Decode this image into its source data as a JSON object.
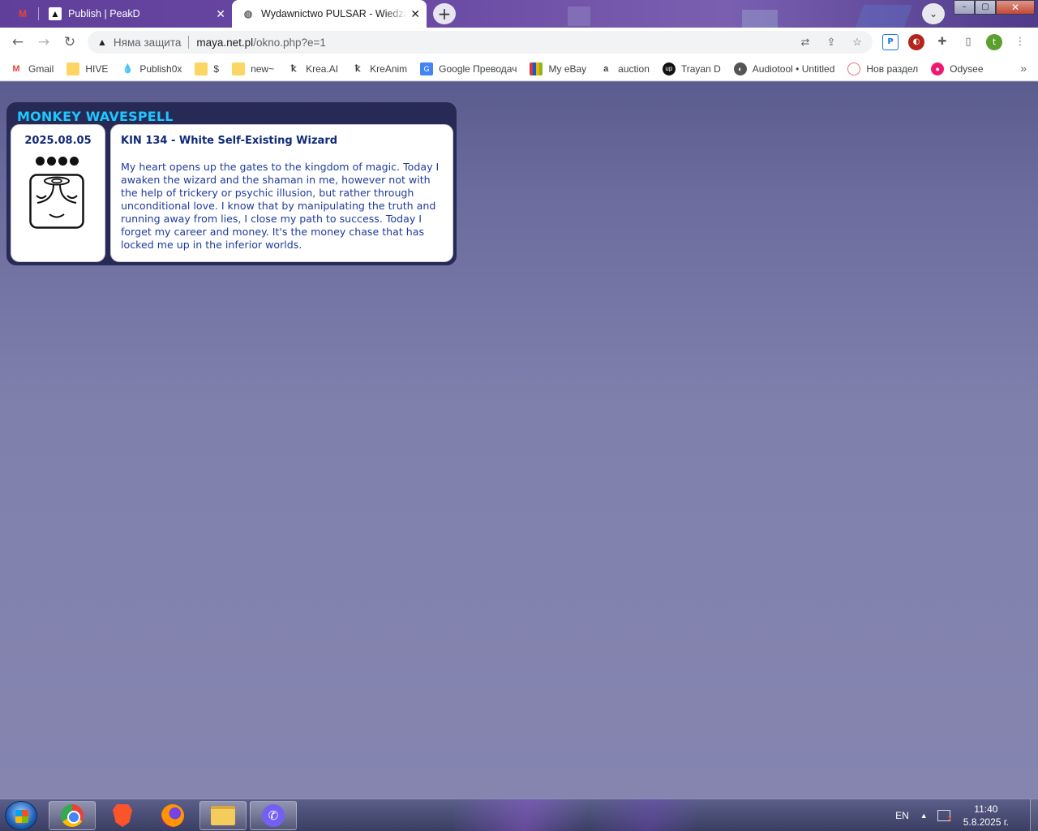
{
  "browser": {
    "tabs": [
      {
        "label": "",
        "icon": "gmail-icon"
      },
      {
        "label": "Publish | PeakD",
        "icon": "peakd-icon"
      },
      {
        "label": "Wydawnictwo PULSAR - Wiedza ",
        "icon": "globe-icon",
        "active": true
      }
    ],
    "new_tab": "+",
    "tab_search": "⌄",
    "window_controls": {
      "minimize": "–",
      "maximize": "▢",
      "close": "✕"
    },
    "omnibox": {
      "security_label": "Няма защита",
      "host": "maya.net.pl",
      "path": "/okno.php?e=1"
    },
    "nav": {
      "back": "←",
      "forward": "→",
      "reload": "↻"
    },
    "profile_initial": "t",
    "bookmarks": [
      {
        "label": "Gmail",
        "icon": "gmail-icon"
      },
      {
        "label": "HIVE",
        "icon": "folder-icon"
      },
      {
        "label": "Publish0x",
        "icon": "publish0x-icon"
      },
      {
        "label": "$",
        "icon": "folder-icon"
      },
      {
        "label": "new~",
        "icon": "folder-icon"
      },
      {
        "label": "Krea.AI",
        "icon": "krea-icon"
      },
      {
        "label": "KreAnim",
        "icon": "krea-icon"
      },
      {
        "label": "Google Преводач",
        "icon": "google-translate-icon"
      },
      {
        "label": "My eBay",
        "icon": "ebay-icon"
      },
      {
        "label": "auction",
        "icon": "amazon-icon"
      },
      {
        "label": "Trayan D",
        "icon": "upwork-icon"
      },
      {
        "label": "Audiotool • Untitled",
        "icon": "audiotool-icon"
      },
      {
        "label": "Нов раздел",
        "icon": "new-section-icon"
      },
      {
        "label": "Odysee",
        "icon": "odysee-icon"
      }
    ],
    "bookmarks_more": "»"
  },
  "widget": {
    "title": "MONKEY WAVESPELL",
    "date": "2025.08.05",
    "tone_dots": 4,
    "kin_title": "KIN 134 - White Self-Existing Wizard",
    "text": "My heart opens up the gates to the kingdom of magic. Today I awaken the wizard and the shaman in me, however not with the help of trickery or psychic illusion, but rather through unconditional love. I know that by manipulating the truth and running away from lies, I close my path to success. Today I forget my career and money. It's the money chase that has locked me up in the inferior worlds."
  },
  "taskbar": {
    "apps": [
      "chrome-icon",
      "brave-icon",
      "firefox-icon",
      "file-explorer-icon",
      "viber-icon"
    ],
    "language": "EN",
    "tray_arrow": "▲",
    "time": "11:40",
    "date": "5.8.2025 г."
  },
  "colors": {
    "widget_title": "#1ec7ff",
    "widget_bg": "#262a55",
    "text_blue": "#1f3b9a",
    "page_bg": "#7b7aa6"
  }
}
